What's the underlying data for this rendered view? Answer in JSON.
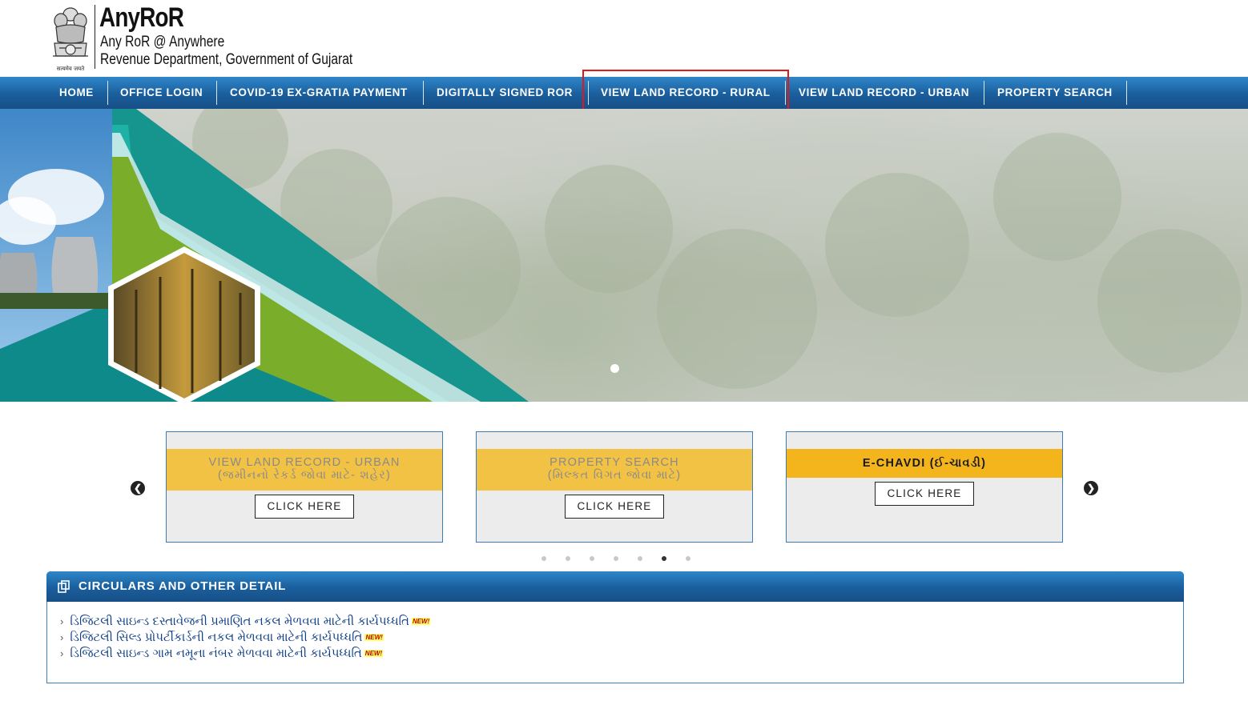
{
  "header": {
    "title": "AnyRoR",
    "subtitle1": "Any RoR @ Anywhere",
    "subtitle2": "Revenue Department, Government of Gujarat",
    "emblem_motto": "सत्यमेव जयते",
    "emblem_icon": "ashoka-emblem-icon"
  },
  "nav": {
    "items": [
      {
        "label": "HOME"
      },
      {
        "label": "OFFICE LOGIN"
      },
      {
        "label": "COVID-19 EX-GRATIA PAYMENT"
      },
      {
        "label": "DIGITALLY SIGNED ROR"
      },
      {
        "label": "VIEW LAND RECORD - RURAL",
        "highlighted": true
      },
      {
        "label": "VIEW LAND RECORD - URBAN"
      },
      {
        "label": "PROPERTY SEARCH"
      }
    ],
    "highlight_color": "#e01818"
  },
  "banner": {
    "slides_total": 1,
    "active_slide": 1
  },
  "cards": {
    "prev_icon": "chevron-left-icon",
    "next_icon": "chevron-right-icon",
    "items": [
      {
        "title": "VIEW LAND RECORD - URBAN",
        "subtitle": "(જમીનનો રેકર્ડ જોવા માટે- શહેર)",
        "button": "CLICK HERE"
      },
      {
        "title": "PROPERTY SEARCH",
        "subtitle": "(મિલ્કત વિગત જોવા માટે)",
        "button": "CLICK HERE"
      },
      {
        "title": "E-CHAVDI (ઈ-ચાવડી)",
        "subtitle": "",
        "button": "CLICK HERE"
      }
    ],
    "dots_total": 7,
    "active_dot": 6
  },
  "circulars": {
    "title": "CIRCULARS AND OTHER DETAIL",
    "icon": "documents-icon",
    "new_label": "NEW!",
    "items": [
      {
        "text": "ડિજિટલી સાઇન્ડ દસ્તાવેજની પ્રમાણિત નકલ મેળવવા માટેની કાર્યપધ્ધતિ",
        "is_new": true
      },
      {
        "text": "ડિજિટલી સિલ્ડ પ્રોપર્ટીકાર્ડની નકલ મેળવવા માટેની કાર્યપધ્ધતિ",
        "is_new": true
      },
      {
        "text": "ડિજિટલી સાઇન્ડ ગામ નમૂના નંબર મેળવવા માટેની કાર્યપધ્ધતિ",
        "is_new": true
      }
    ]
  },
  "colors": {
    "nav_blue": "#1a5e9c",
    "card_yellow": "#f2c244",
    "card_yellow_active": "#f3b51b",
    "card_border": "#3c7cb8",
    "link_blue": "#0f3f86"
  }
}
